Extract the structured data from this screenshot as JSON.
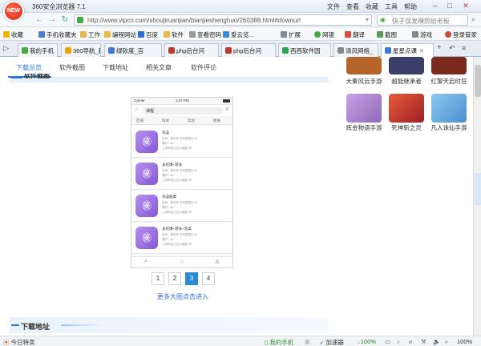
{
  "window": {
    "logo_text": "NEW",
    "app_title": "360安全浏览器 7.1",
    "menu": [
      "文件",
      "查看",
      "收藏",
      "工具",
      "帮助"
    ]
  },
  "address": {
    "url": "http://www.vipcn.com/shoujiruanjian/bianjieshenghuo/260388.html#downurl",
    "search_placeholder": "快子误发裸照给老板"
  },
  "bookmarks": {
    "left": [
      "收藏",
      "手机收藏夹",
      "工作",
      "编程网站",
      "百度",
      "软件",
      "查看密码",
      "爱云览..."
    ],
    "right": [
      "扩展",
      "网银",
      "翻译",
      "截图",
      "游戏",
      "登录管家"
    ]
  },
  "tabs": [
    {
      "label": "我的手机",
      "color": "#3fae3f"
    },
    {
      "label": "360导航_新",
      "color": "#f2a300"
    },
    {
      "label": "绿软度_百",
      "color": "#3b7ad8"
    },
    {
      "label": "php后台问",
      "color": "#c0392b"
    },
    {
      "label": "php后台问",
      "color": "#c0392b"
    },
    {
      "label": "西西软件园",
      "color": "#2aa84a"
    },
    {
      "label": "清风网络_",
      "color": "#888888"
    },
    {
      "label": "星星点课",
      "color": "#3b7ad8"
    }
  ],
  "subtabs": [
    "下载总览",
    "软件截图",
    "下载地址",
    "相关文章",
    "软件评论"
  ],
  "section_partial": "软件截图",
  "phone": {
    "status_carrier": "Carrier",
    "status_time": "1:47 PM",
    "back_label": "课程",
    "filters": [
      "区域",
      "科目",
      "年龄",
      "距离"
    ],
    "items": [
      {
        "title": "洗澡",
        "lines": [
          "年龄：教学员 共有数据(0)15",
          "课时：60",
          "上海市徐汇区大港路1号"
        ]
      },
      {
        "title": "泳装爆+游泳",
        "lines": [
          "年龄：教学员 共有数据(0)15",
          "课时：60",
          "上海市徐汇区大港路1号"
        ]
      },
      {
        "title": "洗澡按摩",
        "lines": [
          "年龄：教学员 共有数据(0)15",
          "课时：60",
          "上海市徐汇区大港路1号"
        ]
      },
      {
        "title": "泳装爆+游泳+洗澡",
        "lines": [
          "年龄：教学员 共有数据(0)15",
          "课时：60",
          "上海市徐汇区大港路1号"
        ]
      }
    ]
  },
  "pagination": {
    "pages": [
      "1",
      "2",
      "3",
      "4"
    ],
    "active": "3"
  },
  "more_link": "更多大图点击进入",
  "download_section": "下载地址",
  "sidebar_games": [
    {
      "label": "大秦风云手游",
      "color": "#b5652a"
    },
    {
      "label": "超能继承者",
      "color": "#3a3f6a"
    },
    {
      "label": "红警天启时狂",
      "color": "#7a2b1e"
    },
    {
      "label": "炼金物语手游",
      "color": "#8f6bb8"
    },
    {
      "label": "死神斩之灵",
      "color": "#9c2024"
    },
    {
      "label": "凡人诛仙手游",
      "color": "#4a8fd0"
    }
  ],
  "statusbar": {
    "left": "今日特卖",
    "my_phone": "我的手机",
    "accelerator": "加速器",
    "download_pct": "100%",
    "zoom": "100%"
  }
}
